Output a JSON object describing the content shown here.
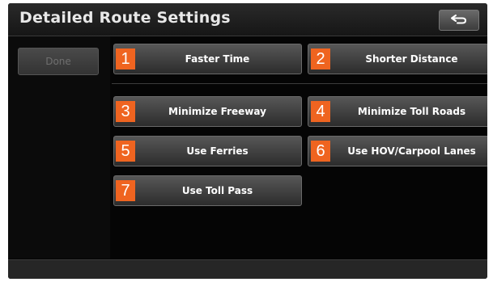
{
  "header": {
    "title": "Detailed Route Settings",
    "back_icon": "return-arrow-icon"
  },
  "left_panel": {
    "done_label": "Done"
  },
  "options": [
    {
      "label": "Faster Time",
      "callout": "1"
    },
    {
      "label": "Shorter Distance",
      "callout": "2"
    },
    {
      "label": "Minimize Freeway",
      "callout": "3"
    },
    {
      "label": "Minimize Toll Roads",
      "callout": "4"
    },
    {
      "label": "Use Ferries",
      "callout": "5"
    },
    {
      "label": "Use HOV/Carpool Lanes",
      "callout": "6"
    },
    {
      "label": "Use Toll Pass",
      "callout": "7"
    }
  ],
  "colors": {
    "callout": "#ef6420",
    "screen_bg": "#050505"
  }
}
